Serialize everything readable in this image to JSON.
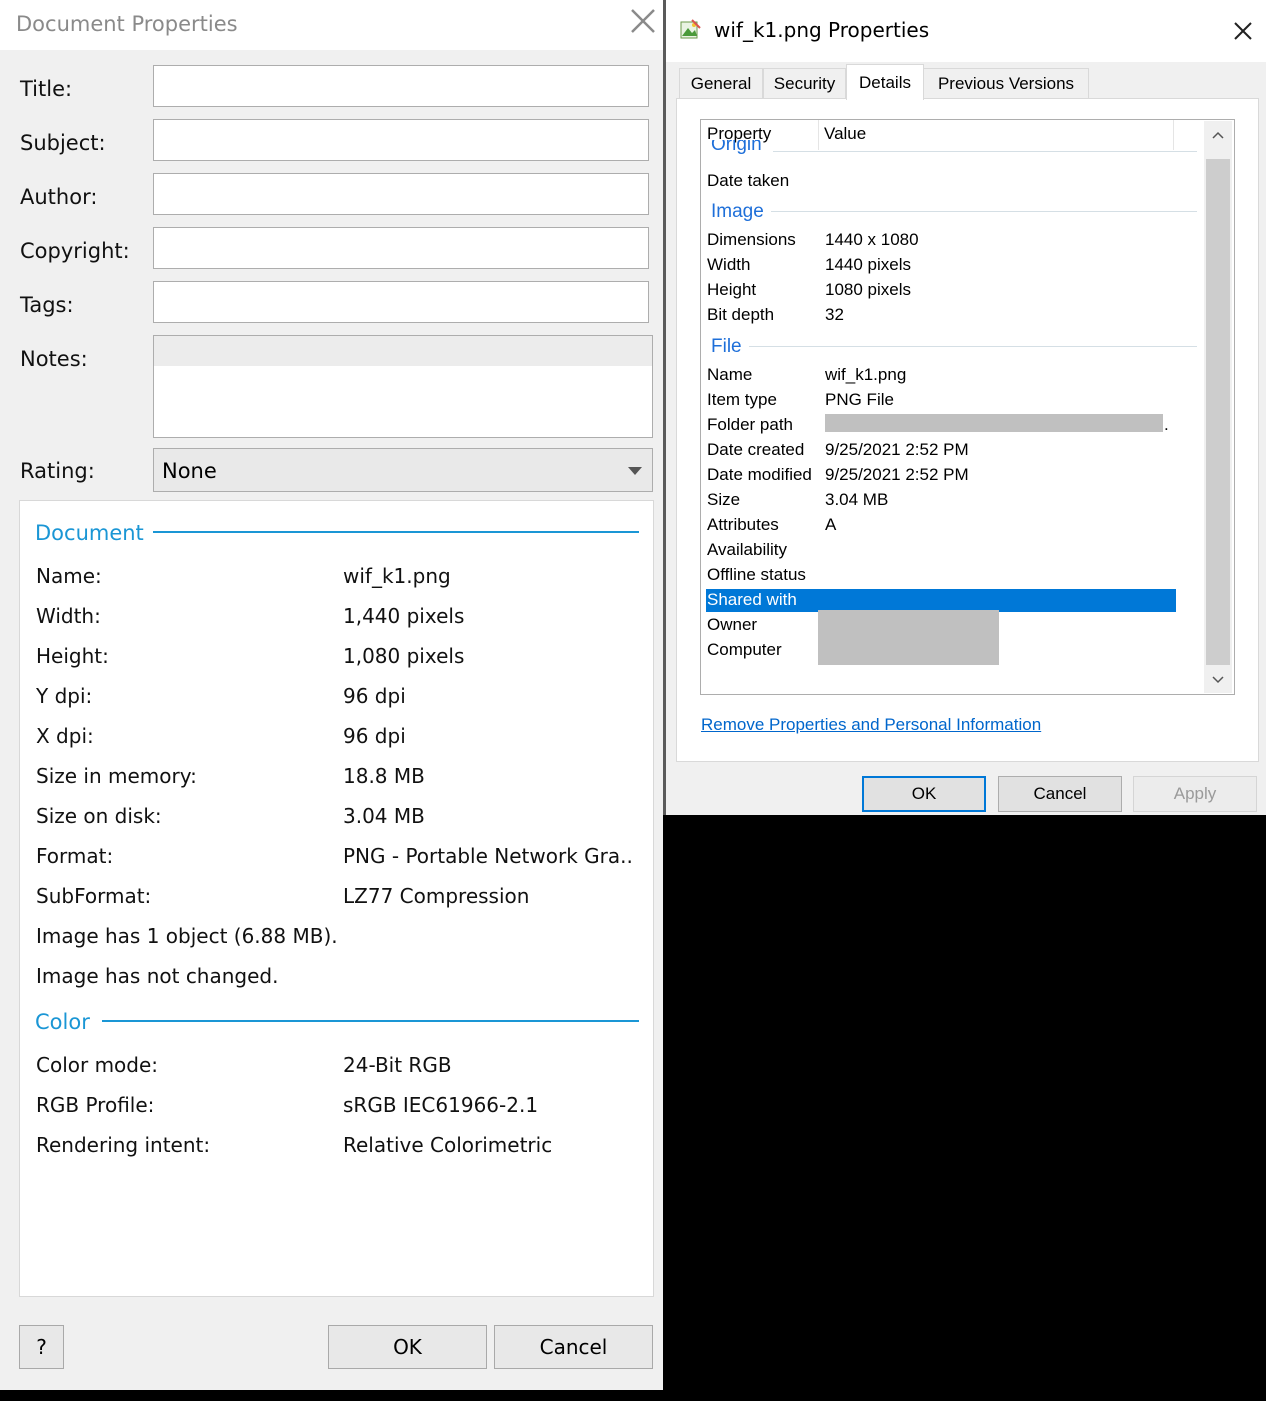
{
  "doc_props": {
    "title": "Document Properties",
    "fields": [
      {
        "label": "Title:",
        "value": ""
      },
      {
        "label": "Subject:",
        "value": ""
      },
      {
        "label": "Author:",
        "value": ""
      },
      {
        "label": "Copyright:",
        "value": ""
      },
      {
        "label": "Tags:",
        "value": ""
      }
    ],
    "notes_label": "Notes:",
    "rating_label": "Rating:",
    "rating_value": "None",
    "document_section": {
      "heading": "Document",
      "rows": [
        {
          "label": "Name:",
          "value": "wif_k1.png"
        },
        {
          "label": "Width:",
          "value": "1,440 pixels"
        },
        {
          "label": "Height:",
          "value": "1,080 pixels"
        },
        {
          "label": "Y dpi:",
          "value": "96 dpi"
        },
        {
          "label": "X dpi:",
          "value": "96 dpi"
        },
        {
          "label": "Size in memory:",
          "value": "18.8 MB"
        },
        {
          "label": "Size on disk:",
          "value": "3.04 MB"
        },
        {
          "label": "Format:",
          "value": "PNG - Portable Network Gra..."
        },
        {
          "label": "SubFormat:",
          "value": "LZ77 Compression"
        }
      ],
      "notes": [
        "Image has 1 object (6.88 MB).",
        "Image has not changed."
      ]
    },
    "color_section": {
      "heading": "Color",
      "rows": [
        {
          "label": "Color mode:",
          "value": "24-Bit RGB"
        },
        {
          "label": "RGB Profile:",
          "value": "sRGB IEC61966-2.1"
        },
        {
          "label": "Rendering intent:",
          "value": "Relative Colorimetric"
        }
      ]
    },
    "buttons": {
      "help": "?",
      "ok": "OK",
      "cancel": "Cancel"
    },
    "accent_color": "#1a96d5"
  },
  "file_props": {
    "title": "wif_k1.png Properties",
    "tabs": [
      "General",
      "Security",
      "Details",
      "Previous Versions"
    ],
    "active_tab": "Details",
    "columns": {
      "property": "Property",
      "value": "Value"
    },
    "groups": {
      "origin": {
        "name": "Origin",
        "rows": [
          {
            "label": "Date taken",
            "value": ""
          }
        ]
      },
      "image": {
        "name": "Image",
        "rows": [
          {
            "label": "Dimensions",
            "value": "1440 x 1080"
          },
          {
            "label": "Width",
            "value": "1440 pixels"
          },
          {
            "label": "Height",
            "value": "1080 pixels"
          },
          {
            "label": "Bit depth",
            "value": "32"
          }
        ]
      },
      "file": {
        "name": "File",
        "rows": [
          {
            "label": "Name",
            "value": "wif_k1.png"
          },
          {
            "label": "Item type",
            "value": "PNG File"
          },
          {
            "label": "Folder path",
            "value": ""
          },
          {
            "label": "Date created",
            "value": "9/25/2021 2:52 PM"
          },
          {
            "label": "Date modified",
            "value": "9/25/2021 2:52 PM"
          },
          {
            "label": "Size",
            "value": "3.04 MB"
          },
          {
            "label": "Attributes",
            "value": "A"
          },
          {
            "label": "Availability",
            "value": ""
          },
          {
            "label": "Offline status",
            "value": ""
          },
          {
            "label": "Shared with",
            "value": ""
          },
          {
            "label": "Owner",
            "value": ""
          },
          {
            "label": "Computer",
            "value": ""
          }
        ]
      }
    },
    "selected_row": "Shared with",
    "folder_path_suffix": ".",
    "link": "Remove Properties and Personal Information",
    "buttons": {
      "ok": "OK",
      "cancel": "Cancel",
      "apply": "Apply"
    },
    "selection_color": "#0078d7",
    "group_color": "#1e6fd9"
  }
}
